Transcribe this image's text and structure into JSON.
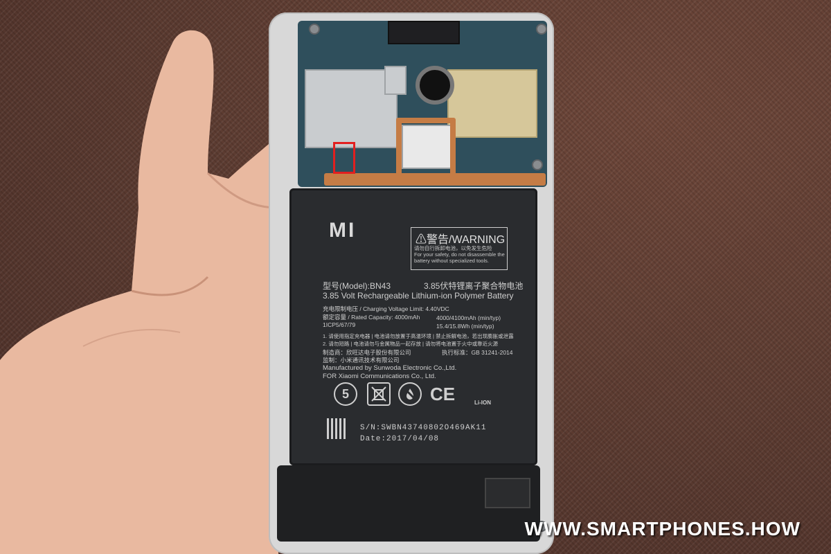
{
  "photo": {
    "subject": "",
    "highlight_color": "#e21f1f"
  },
  "battery": {
    "brand_logo": "MI",
    "warning_title": "⚠警告/WARNING",
    "warning_cn": "请勿自行拆卸电池，以免发生危险",
    "warning_en": "For your safety, do not disassemble the battery without specialized tools.",
    "model": "型号(Model):BN43",
    "model_cn": "3.85伏特锂离子聚合物电池",
    "description": "3.85 Volt Rechargeable Lithium-ion Polymer Battery",
    "charge_limit": "充电限制电压 / Charging Voltage Limit: 4.40VDC",
    "rated_capacity": "额定容量 / Rated Capacity: 4000mAh",
    "capacity_values": "4000/4100mAh (min/typ)",
    "cell_code": "1ICP5/67/79",
    "energy_values": "15.4/15.8Wh (min/typ)",
    "notes_cn_1": "1. 请使用指定充电器 | 电池请勿放置于高温环境 | 禁止拆解电池，若出现膨胀或泄露",
    "notes_cn_2": "2. 请勿短路 | 电池请勿与金属物品一起存放 | 请勿将电池置于火中或靠近火源",
    "maker_cn": "制造商：欣旺达电子股份有限公司",
    "standard": "执行标准：GB 31241-2014",
    "supplier_cn": "监制：小米通讯技术有限公司",
    "manufacturer_en": "Manufactured by Sunwoda Electronic Co.,Ltd.",
    "for_en": "FOR Xiaomi Communications Co., Ltd.",
    "cert_icons": [
      "recycle-5-icon",
      "no-trash-bin-icon",
      "no-fire-icon",
      "ce-mark-icon",
      "li-ion-recycle-icon"
    ],
    "cert_labels": [
      "5",
      "",
      "",
      "CE",
      "Li-ION"
    ],
    "serial": "S/N:SWBN43740802O469AK11",
    "date": "Date:2017/04/08"
  },
  "watermark": "WWW.SMARTPHONES.HOW"
}
